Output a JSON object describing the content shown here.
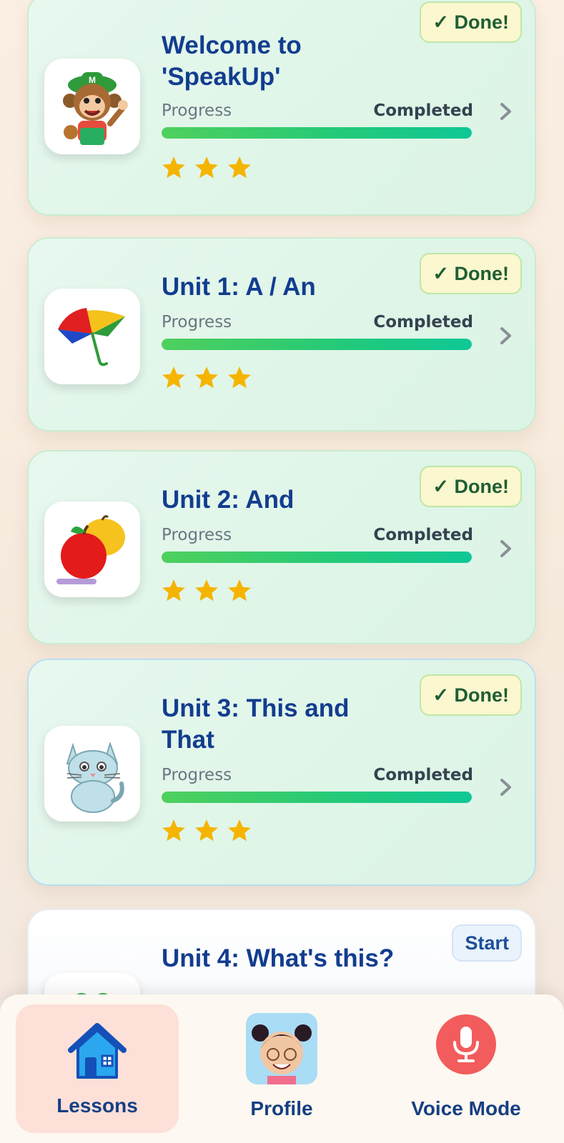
{
  "lessons": [
    {
      "title": "Welcome to 'SpeakUp'",
      "progress_label": "Progress",
      "status": "Completed",
      "progress": 1.0,
      "stars": 3,
      "badge": "✓ Done!",
      "icon": "monkey-icon"
    },
    {
      "title": "Unit 1: A / An",
      "progress_label": "Progress",
      "status": "Completed",
      "progress": 1.0,
      "stars": 3,
      "badge": "✓ Done!",
      "icon": "umbrella-icon"
    },
    {
      "title": "Unit 2: And",
      "progress_label": "Progress",
      "status": "Completed",
      "progress": 1.0,
      "stars": 3,
      "badge": "✓ Done!",
      "icon": "apple-icon"
    },
    {
      "title": "Unit 3: This and That",
      "progress_label": "Progress",
      "status": "Completed",
      "progress": 1.0,
      "stars": 3,
      "badge": "✓ Done!",
      "icon": "cat-icon"
    },
    {
      "title": "Unit 4: What's this?",
      "start_label": "Start",
      "icon": "frog-icon"
    }
  ],
  "nav": {
    "lessons": "Lessons",
    "profile": "Profile",
    "voice": "Voice Mode"
  },
  "colors": {
    "title": "#123d8f",
    "progress_bar": "#22c97a",
    "star": "#f5b400",
    "done_text": "#1f5d33",
    "voice_button": "#f25c5c"
  }
}
